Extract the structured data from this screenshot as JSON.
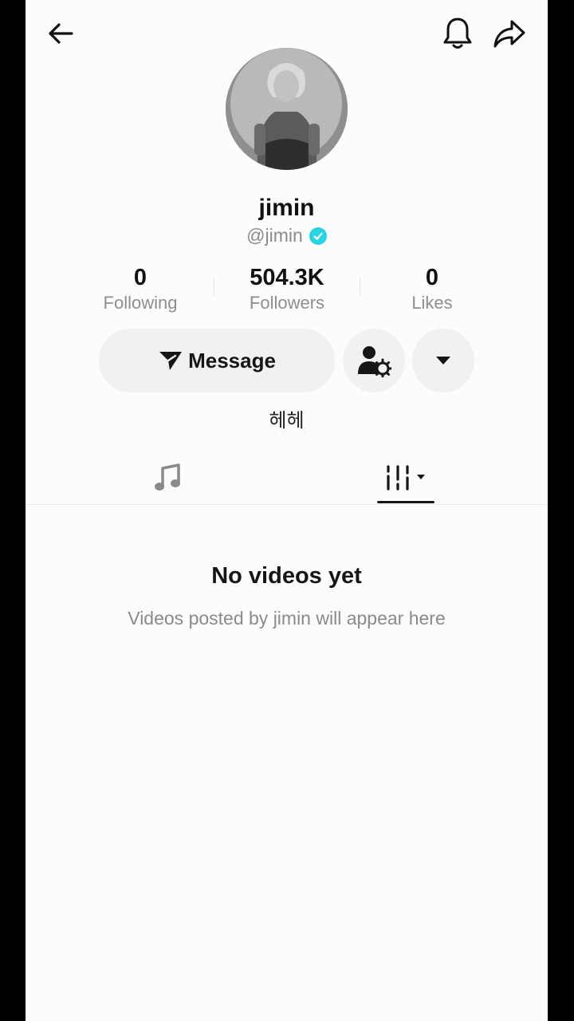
{
  "header": {
    "back_icon": "arrow-left-icon",
    "bell_icon": "bell-icon",
    "share_icon": "share-arrow-icon"
  },
  "profile": {
    "display_name": "jimin",
    "handle": "@jimin",
    "verified_color": "#27d4e6",
    "bio": "헤헤"
  },
  "stats": [
    {
      "value": "0",
      "label": "Following"
    },
    {
      "value": "504.3K",
      "label": "Followers"
    },
    {
      "value": "0",
      "label": "Likes"
    }
  ],
  "actions": {
    "message_label": "Message",
    "add_friend_icon": "person-settings-icon",
    "more_icon": "caret-down-icon"
  },
  "tabs": [
    {
      "icon": "music-note-icon",
      "selected": false
    },
    {
      "icon": "filter-bars-icon",
      "selected": true
    }
  ],
  "empty_state": {
    "title": "No videos yet",
    "subtitle": "Videos posted by jimin will appear here"
  }
}
